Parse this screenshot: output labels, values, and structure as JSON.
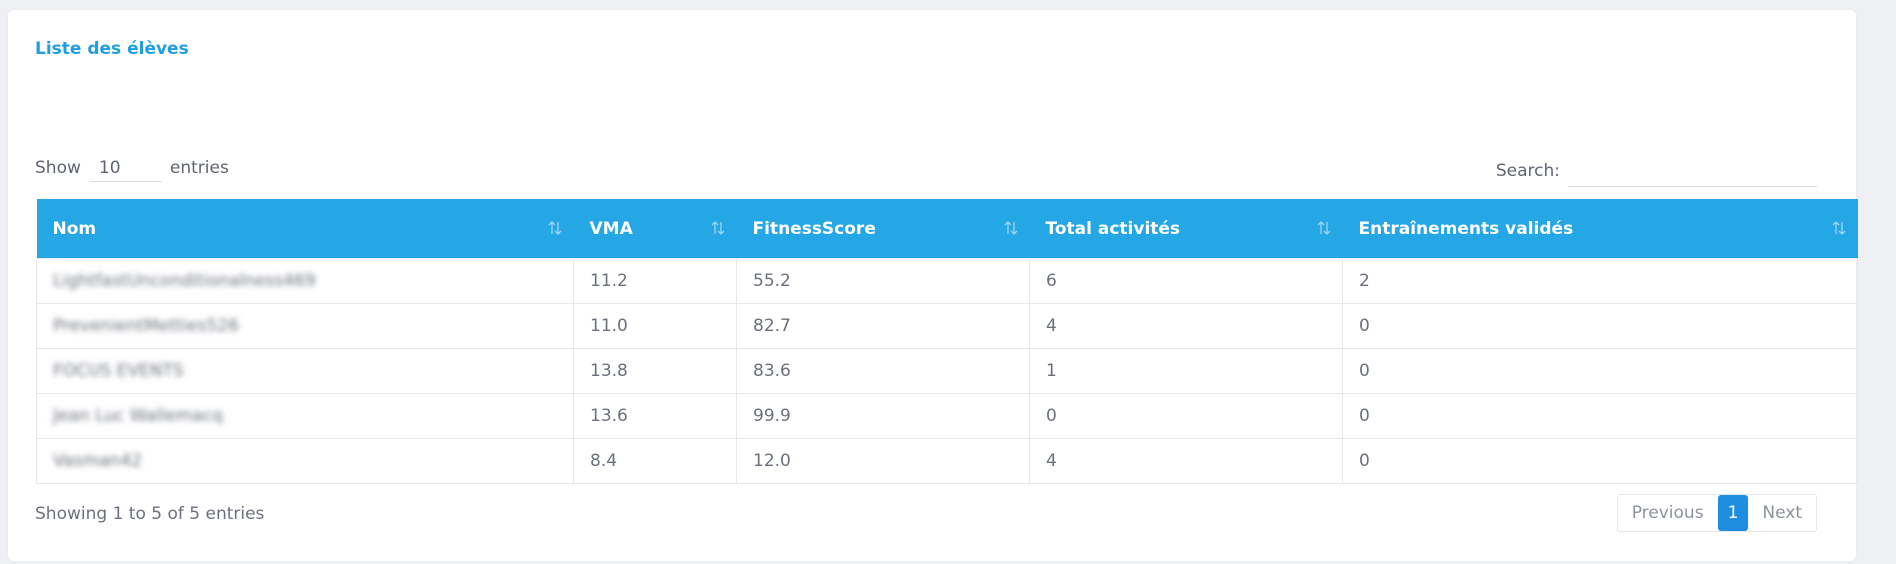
{
  "card": {
    "title": "Liste des élèves"
  },
  "length": {
    "prefix": "Show",
    "value": "10",
    "suffix": "entries"
  },
  "search": {
    "label": "Search:",
    "value": ""
  },
  "table": {
    "columns": [
      "Nom",
      "VMA",
      "FitnessScore",
      "Total activités",
      "Entraînements validés"
    ],
    "rows": [
      [
        "LightfastUnconditionalness469",
        "11.2",
        "55.2",
        "6",
        "2"
      ],
      [
        "PrevenientMetties526",
        "11.0",
        "82.7",
        "4",
        "0"
      ],
      [
        "FOCUS EVENTS",
        "13.8",
        "83.6",
        "1",
        "0"
      ],
      [
        "Jean Luc Wallemacq",
        "13.6",
        "99.9",
        "0",
        "0"
      ],
      [
        "Vasman42",
        "8.4",
        "12.0",
        "4",
        "0"
      ]
    ]
  },
  "info": "Showing 1 to 5 of 5 entries",
  "pagination": {
    "previous": "Previous",
    "current": "1",
    "next": "Next"
  },
  "colors": {
    "accent": "#25a6e5",
    "title": "#1f9ee0",
    "active_page": "#1f8de0"
  },
  "icons": {
    "sort": "sort-arrows-icon"
  }
}
